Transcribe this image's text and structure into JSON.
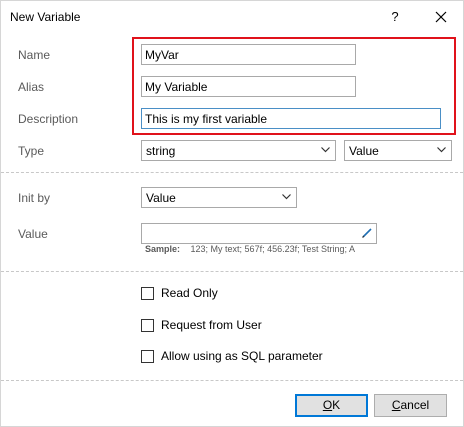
{
  "window": {
    "title": "New Variable",
    "help_label": "?",
    "close_label": "✕"
  },
  "fields": {
    "name": {
      "label": "Name",
      "value": "MyVar"
    },
    "alias": {
      "label": "Alias",
      "value": "My Variable"
    },
    "description": {
      "label": "Description",
      "value": "This is my first variable"
    },
    "type": {
      "label": "Type",
      "value": "string",
      "mode": "Value"
    }
  },
  "init": {
    "label": "Init by",
    "value": "Value",
    "value_label": "Value",
    "value_text": "",
    "sample_title": "Sample:",
    "sample_text": "123;  My text;  567f;  456.23f;  Test String;  A"
  },
  "options": [
    {
      "label": "Read Only",
      "checked": false
    },
    {
      "label": "Request from User",
      "checked": false
    },
    {
      "label": "Allow using as SQL parameter",
      "checked": false
    }
  ],
  "buttons": {
    "ok_mnemonic": "O",
    "ok_rest": "K",
    "cancel_mnemonic": "C",
    "cancel_rest": "ancel"
  },
  "colors": {
    "highlight": "#e0121b",
    "focus_border": "#4a8fc6",
    "default_button_border": "#0078d7"
  }
}
